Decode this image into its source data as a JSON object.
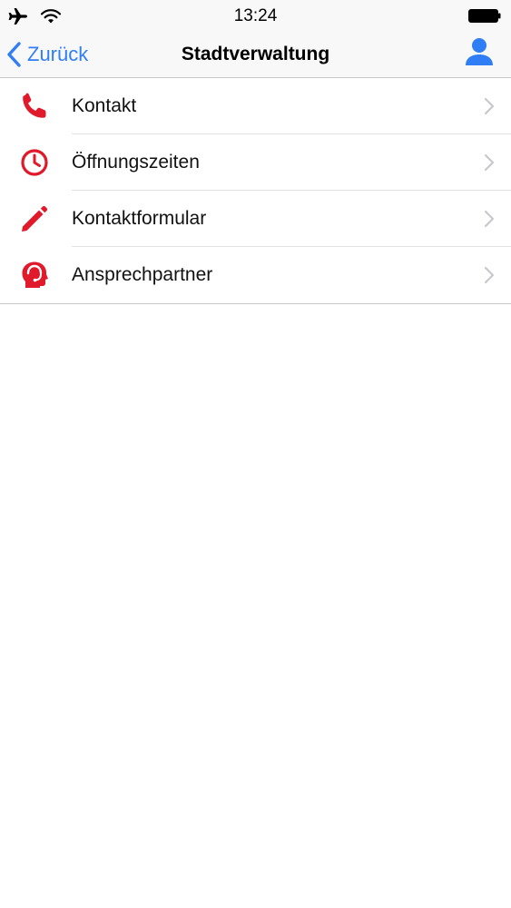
{
  "status_bar": {
    "time": "13:24",
    "icons": [
      "airplane-icon",
      "wifi-icon",
      "battery-icon"
    ]
  },
  "nav": {
    "back_label": "Zurück",
    "title": "Stadtverwaltung",
    "right_icon": "person-icon"
  },
  "colors": {
    "accent_blue": "#2f7ef6",
    "icon_red": "#e0192b",
    "chevron_gray": "#c7c7cc"
  },
  "menu": {
    "items": [
      {
        "label": "Kontakt",
        "icon": "phone-icon"
      },
      {
        "label": "Öffnungszeiten",
        "icon": "clock-icon"
      },
      {
        "label": "Kontaktformular",
        "icon": "pencil-icon"
      },
      {
        "label": "Ansprechpartner",
        "icon": "headset-person-icon"
      }
    ]
  }
}
